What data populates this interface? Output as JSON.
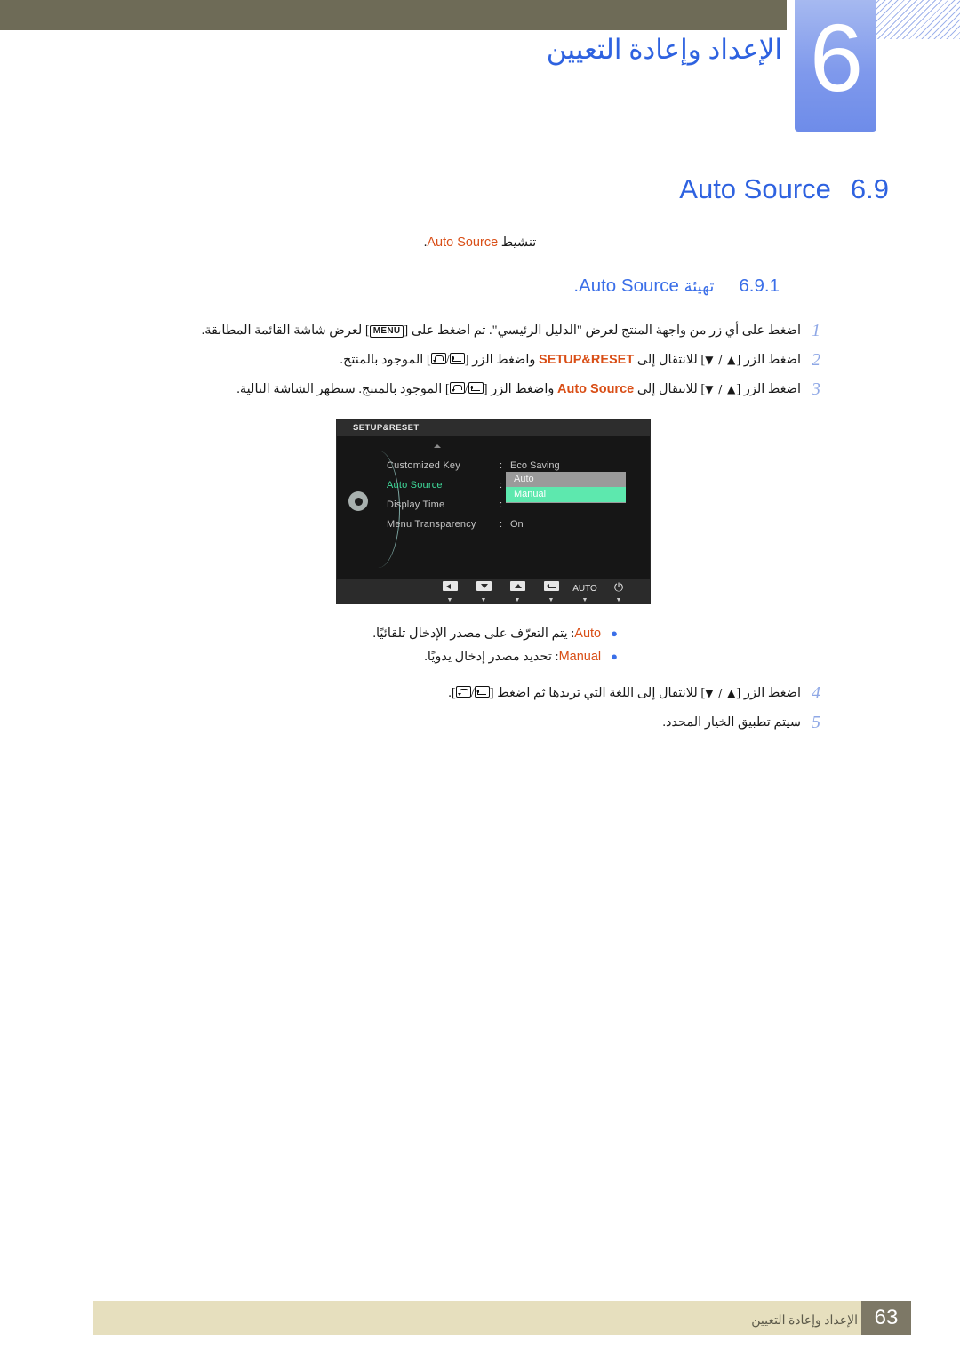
{
  "header": {
    "chapter_number": "6",
    "chapter_title": "الإعداد وإعادة التعيين"
  },
  "section": {
    "number": "6.9",
    "title_en": "Auto Source",
    "intro_ar": "تنشيط",
    "intro_en": "Auto Source",
    "intro_tail": "."
  },
  "subsection": {
    "number": "6.9.1",
    "title_ar": "تهيئة",
    "title_en": "Auto Source",
    "title_tail": "."
  },
  "steps": [
    {
      "num": "1",
      "seg_a": "اضغط على أي زر من واجهة المنتج لعرض \"الدليل الرئيسي\". ثم اضغط على [",
      "key": "MENU",
      "seg_b": "] لعرض شاشة القائمة المطابقة."
    },
    {
      "num": "2",
      "seg_a": "اضغط الزر [",
      "arrows": "▲ / ▼",
      "seg_b": "] للانتقال إلى ",
      "highlight": "SETUP&RESET",
      "seg_c": " واضغط الزر [",
      "seg_d": "] الموجود بالمنتج."
    },
    {
      "num": "3",
      "seg_a": "اضغط الزر [",
      "arrows": "▲ / ▼",
      "seg_b": "] للانتقال إلى ",
      "highlight": "Auto Source",
      "seg_c": " واضغط الزر [",
      "seg_d": "] الموجود بالمنتج. ستظهر الشاشة التالية."
    },
    {
      "num": "4",
      "seg_a": "اضغط الزر [",
      "arrows": "▲ / ▼",
      "seg_b": "] للانتقال إلى اللغة التي تريدها ثم اضغط [",
      "seg_d": "]."
    },
    {
      "num": "5",
      "seg_a": "سيتم تطبيق الخيار المحدد."
    }
  ],
  "osd": {
    "title": "SETUP&RESET",
    "rows": [
      {
        "label": "Customized Key",
        "colon": ":",
        "value": "Eco Saving",
        "active": false
      },
      {
        "label": "Auto Source",
        "colon": ":",
        "value": "",
        "active": true
      },
      {
        "label": "Display Time",
        "colon": ":",
        "value": "",
        "active": false
      },
      {
        "label": "Menu Transparency",
        "colon": ":",
        "value": "On",
        "active": false
      }
    ],
    "dropdown_options": [
      "Auto",
      "Manual"
    ],
    "dropdown_selected": "Manual",
    "footer_keys": [
      {
        "icon": "left-arrow-key",
        "label": ""
      },
      {
        "icon": "down-arrow-key",
        "label": ""
      },
      {
        "icon": "up-arrow-key",
        "label": ""
      },
      {
        "icon": "enter-key",
        "label": ""
      },
      {
        "icon": "auto-key",
        "label": "AUTO"
      },
      {
        "icon": "power-key",
        "label": "⏻"
      }
    ]
  },
  "bullets": [
    {
      "term": "Auto",
      "text": ": يتم التعرّف على مصدر الإدخال تلقائيًا."
    },
    {
      "term": "Manual",
      "text": ": تحديد مصدر إدخال يدويًا."
    }
  ],
  "footer": {
    "text": "الإعداد وإعادة التعيين",
    "page": "63"
  },
  "colors": {
    "header_bar": "#6e6b57",
    "chapter_blue": "#7f99ec",
    "title_blue": "#2e62e0",
    "accent_orange": "#d94e16",
    "footer_beige": "#e6dfbe",
    "footer_page_box": "#7d7866",
    "osd_green": "#3fd99a"
  }
}
